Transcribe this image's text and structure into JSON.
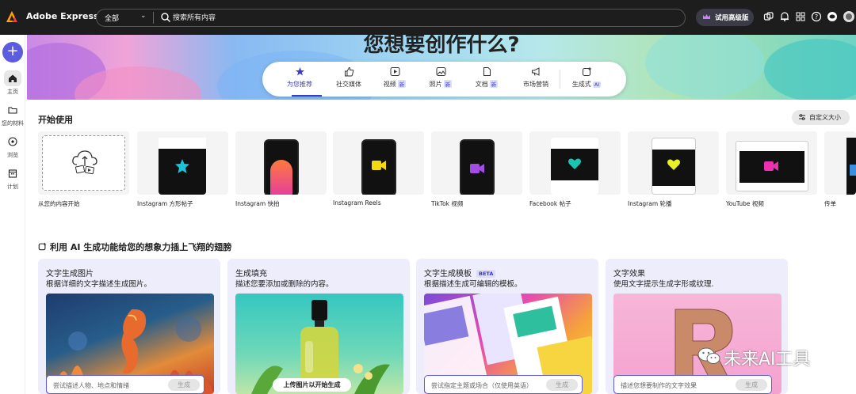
{
  "app": {
    "title": "Adobe Express"
  },
  "search": {
    "scope": "全部",
    "placeholder": "搜索所有内容"
  },
  "upgrade": {
    "label": "试用高级版"
  },
  "sidebar": {
    "items": [
      {
        "label": "主页"
      },
      {
        "label": "您的材料"
      },
      {
        "label": "浏览"
      },
      {
        "label": "计划"
      }
    ]
  },
  "hero": {
    "title": "您想要创作什么?"
  },
  "tabs": [
    {
      "label": "为您推荐",
      "badge": ""
    },
    {
      "label": "社交媒体",
      "badge": ""
    },
    {
      "label": "视频",
      "badge": "新"
    },
    {
      "label": "照片",
      "badge": "新"
    },
    {
      "label": "文档",
      "badge": "新"
    },
    {
      "label": "市场营销",
      "badge": ""
    },
    {
      "label": "生成式",
      "badge": "AI"
    }
  ],
  "start": {
    "title": "开始使用",
    "custom_size": "自定义大小",
    "cards": [
      {
        "label": "从您的内容开始"
      },
      {
        "label": "Instagram 方形帖子"
      },
      {
        "label": "Instagram 快拍"
      },
      {
        "label": "Instagram Reels"
      },
      {
        "label": "TikTok 视频"
      },
      {
        "label": "Facebook 帖子"
      },
      {
        "label": "Instagram 轮播"
      },
      {
        "label": "YouTube 视频"
      },
      {
        "label": "传单"
      }
    ]
  },
  "ai": {
    "title": "利用 AI 生成功能给您的想象力插上飞翔的翅膀",
    "cards": [
      {
        "title": "文字生成图片",
        "desc": "根据详细的文字描述生成图片。",
        "placeholder": "尝试描述人物、地点和情绪",
        "button": "生成"
      },
      {
        "title": "生成填充",
        "desc": "描述您要添加或删除的内容。",
        "upload": "上传图片以开始生成"
      },
      {
        "title": "文字生成模板",
        "beta": "BETA",
        "desc": "根据描述生成可编辑的模板。",
        "placeholder": "尝试指定主题或场合（仅使用英语）",
        "button": "生成"
      },
      {
        "title": "文字效果",
        "desc": "使用文字提示生成字形或纹理.",
        "placeholder": "描述您想要制作的文字效果",
        "button": "生成"
      }
    ]
  },
  "watermark": {
    "text": "未来AI工具"
  }
}
